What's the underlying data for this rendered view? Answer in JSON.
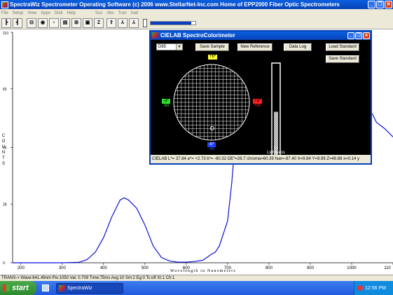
{
  "app": {
    "title": "SpectraWiz  Spectrometer Operating Software (c) 2006  www.StellarNet-Inc.com  Home of EPP2000 Fiber Optic Spectrometers"
  },
  "menu": [
    "File",
    "Setup",
    "View",
    "Apps",
    "Disk",
    "Help",
    "Sco",
    "Abs",
    "Tran",
    "Irad"
  ],
  "toolbar": {
    "buttons": [
      "┣",
      "┫",
      "⊟",
      "◉",
      "♀",
      "▤",
      "⊞",
      "▣",
      "Z",
      "⇧",
      "⅄",
      "⅄"
    ],
    "progress_fraction": 0.9
  },
  "plot": {
    "ylabel": "COUNTS",
    "xlabel": "Wavelength in Nanometers",
    "xticks": [
      "200",
      "300",
      "400",
      "500",
      "600",
      "700",
      "800",
      "900",
      "1000",
      "110"
    ],
    "yticks": [
      "110",
      "83",
      "55",
      "28",
      "0"
    ]
  },
  "status": {
    "text": "TRANS-> Wave:641.49nm  Pix:1050  Val:  0.709  Time:75ms  Avg:10  Sm:2  Eg:0  Tc:off  Xt:1  Ch:1"
  },
  "taskbar": {
    "start": "start",
    "item": "SpectraWiz",
    "clock": "12:56 PM"
  },
  "dialog": {
    "title": "CIELAB SpectroColorimeter",
    "illuminant": "D65",
    "buttons": {
      "save_sample": "Save Sample",
      "new_reference": "New Reference",
      "data_log": "Data Log",
      "load_standard": "Load Standard",
      "save_standard": "Save Standard"
    },
    "labels": {
      "b_plus": "+b*",
      "a_minus": "-a*",
      "a_minus_val": "-90",
      "a_plus": "+a*",
      "a_plus_val": "+90",
      "b_minus": "-b*",
      "b_minus_val": "-90",
      "lstar": "L*",
      "lightness": "Lightness"
    },
    "lightness_fraction": 0.48,
    "readout": "CIELAB L*= 37.84  a*= +2.73  b*= -60.32  DE*=26.7  chroma=60.39  hue=-87.40  X=9.84  Y=9.99  Z=48.88  x=0.14  y"
  },
  "chart_data": {
    "type": "line",
    "xlabel": "Wavelength in Nanometers",
    "ylabel": "COUNTS",
    "xlim": [
      180,
      1100
    ],
    "ylim": [
      0,
      110
    ],
    "x": [
      180,
      250,
      300,
      340,
      360,
      380,
      400,
      420,
      440,
      450,
      460,
      480,
      500,
      520,
      540,
      560,
      580,
      600,
      620,
      640,
      650,
      660,
      670,
      680,
      700,
      710,
      720,
      730,
      760,
      800,
      850,
      900,
      950,
      1000,
      1030,
      1050,
      1060,
      1080,
      1100
    ],
    "y": [
      0,
      0,
      0,
      0.2,
      1.5,
      5,
      12,
      22,
      30,
      31,
      30,
      26,
      18,
      8,
      2.5,
      0.8,
      0.3,
      0.3,
      0.6,
      1.2,
      2.5,
      4,
      5,
      8,
      20,
      38,
      62,
      73,
      82,
      82,
      81,
      79,
      77,
      75,
      73,
      71,
      67,
      64,
      60
    ],
    "series": [
      {
        "values_color": "#1010d8"
      }
    ],
    "grid": false
  }
}
